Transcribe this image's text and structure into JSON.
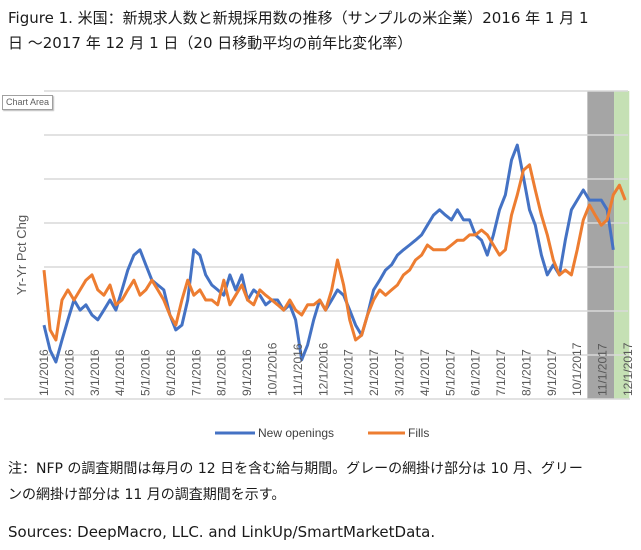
{
  "title_line1": "Figure 1. 米国：新規求人数と新規採用数の推移（サンプルの米企業）2016 年 1 月 1",
  "title_line2": "日 ～2017 年 12 月 1 日（20 日移動平均の前年比変化率）",
  "tooltip": "Chart Area",
  "note_line1": "注：NFP の調査期間は毎月の 12 日を含む給与期間。グレーの網掛け部分は 10 月、グリー",
  "note_line2": "ンの網掛け部分は 11 月の調査期間を示す。",
  "sources": "Sources: DeepMacro, LLC. and LinkUp/SmartMarketData.",
  "colors": {
    "new_openings": "#4472C4",
    "fills": "#ED7D31",
    "gray_band": "#A5A5A5",
    "green_band": "#C5E0B4",
    "grid": "#D9D9D9",
    "axis_text": "#595959"
  },
  "chart_data": {
    "type": "line",
    "title": "",
    "xlabel": "",
    "ylabel": "Yr-Yr Pct Chg",
    "y_tick_labels_shown": false,
    "y_units": "gridline index (unlabeled axis)",
    "ylim": [
      -1,
      6
    ],
    "y_gridlines": [
      0,
      1,
      2,
      3,
      4,
      5,
      6
    ],
    "grid": true,
    "legend_position": "bottom",
    "x_start": "1/1/2016",
    "x_end": "12/1/2017",
    "x_months": 23,
    "tick_labels": [
      "1/1/2016",
      "2/1/2016",
      "3/1/2016",
      "4/1/2016",
      "5/1/2016",
      "6/1/2016",
      "7/1/2016",
      "8/1/2016",
      "9/1/2016",
      "10/1/2016",
      "11/1/2016",
      "12/1/2016",
      "1/1/2017",
      "2/1/2017",
      "3/1/2017",
      "4/1/2017",
      "5/1/2017",
      "6/1/2017",
      "7/1/2017",
      "8/1/2017",
      "9/1/2017",
      "10/1/2017",
      "11/1/2017",
      "12/1/2017"
    ],
    "shaded_regions": [
      {
        "label": "October survey period",
        "color": "gray",
        "from_month": 21.4,
        "to_month": 22.45
      },
      {
        "label": "November survey period",
        "color": "green",
        "from_month": 22.45,
        "to_month": 23.05
      }
    ],
    "x_month_index": [
      0,
      0.24,
      0.47,
      0.71,
      0.94,
      1.18,
      1.42,
      1.65,
      1.89,
      2.12,
      2.36,
      2.6,
      2.83,
      3.07,
      3.3,
      3.54,
      3.78,
      4.01,
      4.25,
      4.48,
      4.72,
      4.96,
      5.19,
      5.43,
      5.66,
      5.9,
      6.14,
      6.37,
      6.61,
      6.84,
      7.08,
      7.32,
      7.55,
      7.79,
      8.02,
      8.26,
      8.5,
      8.73,
      8.97,
      9.2,
      9.44,
      9.68,
      9.91,
      10.15,
      10.38,
      10.62,
      10.86,
      11.09,
      11.33,
      11.56,
      11.8,
      12.04,
      12.27,
      12.51,
      12.74,
      12.98,
      13.22,
      13.45,
      13.69,
      13.92,
      14.16,
      14.4,
      14.63,
      14.87,
      15.1,
      15.34,
      15.58,
      15.81,
      16.05,
      16.28,
      16.52,
      16.76,
      16.99,
      17.23,
      17.46,
      17.7,
      17.94,
      18.17,
      18.41,
      18.64,
      18.88,
      19.12,
      19.35,
      19.59,
      19.82,
      20.06,
      20.3,
      20.53,
      20.77,
      21,
      21.24,
      21.48,
      21.71,
      21.95,
      22.18,
      22.42,
      22.66,
      22.89
    ],
    "series": [
      {
        "name": "New openings",
        "values": [
          0.68,
          0.11,
          -0.16,
          0.34,
          0.8,
          1.25,
          1.02,
          1.14,
          0.91,
          0.8,
          1.02,
          1.25,
          1.02,
          1.48,
          1.93,
          2.27,
          2.39,
          2.05,
          1.7,
          1.59,
          1.48,
          0.91,
          0.57,
          0.68,
          1.25,
          2.39,
          2.27,
          1.82,
          1.59,
          1.48,
          1.36,
          1.82,
          1.48,
          1.82,
          1.25,
          1.48,
          1.36,
          1.14,
          1.25,
          1.25,
          1.02,
          1.14,
          0.8,
          -0.11,
          0.23,
          0.8,
          1.25,
          1.02,
          1.25,
          1.48,
          1.36,
          1.02,
          0.68,
          0.45,
          0.91,
          1.48,
          1.7,
          1.93,
          2.05,
          2.27,
          2.39,
          2.5,
          2.61,
          2.73,
          2.95,
          3.18,
          3.3,
          3.18,
          3.07,
          3.3,
          3.07,
          3.07,
          2.73,
          2.61,
          2.27,
          2.73,
          3.3,
          3.64,
          4.43,
          4.77,
          4.05,
          3.3,
          2.95,
          2.27,
          1.82,
          2.05,
          1.82,
          2.61,
          3.3,
          3.52,
          3.75,
          3.52,
          3.52,
          3.52,
          3.3,
          2.39
        ]
      },
      {
        "name": "Fills",
        "values": [
          1.93,
          0.57,
          0.34,
          1.25,
          1.48,
          1.25,
          1.48,
          1.7,
          1.82,
          1.48,
          1.36,
          1.59,
          1.14,
          1.25,
          1.48,
          1.7,
          1.36,
          1.48,
          1.7,
          1.48,
          1.25,
          0.91,
          0.68,
          1.25,
          1.7,
          1.36,
          1.48,
          1.25,
          1.25,
          1.14,
          1.7,
          1.14,
          1.36,
          1.59,
          1.25,
          1.14,
          1.48,
          1.36,
          1.25,
          1.14,
          1.02,
          1.25,
          1.02,
          0.91,
          1.14,
          1.14,
          1.25,
          1.02,
          1.48,
          2.16,
          1.59,
          0.8,
          0.34,
          0.45,
          0.91,
          1.25,
          1.48,
          1.36,
          1.48,
          1.59,
          1.82,
          1.93,
          2.16,
          2.27,
          2.5,
          2.39,
          2.39,
          2.39,
          2.5,
          2.61,
          2.61,
          2.73,
          2.73,
          2.84,
          2.73,
          2.5,
          2.27,
          2.39,
          3.18,
          3.64,
          4.2,
          4.32,
          3.75,
          3.18,
          2.73,
          2.16,
          1.82,
          1.93,
          1.82,
          2.39,
          3.07,
          3.41,
          3.18,
          2.95,
          3.07,
          3.64,
          3.86,
          3.52
        ]
      }
    ]
  }
}
